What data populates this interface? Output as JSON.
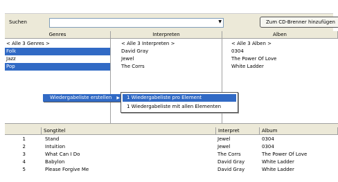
{
  "search": {
    "label": "Suchen",
    "value": "",
    "cd_button": "Zum CD-Brenner hinzufügen"
  },
  "panes": {
    "genres": {
      "header": "Genres",
      "items": [
        "< Alle 3 Genres >",
        "Folk",
        "Jazz",
        "Pop"
      ]
    },
    "artists": {
      "header": "Interpreten",
      "items": [
        "< Alle 3 Interpreten >",
        "David Gray",
        "Jewel",
        "The Corrs"
      ]
    },
    "albums": {
      "header": "Alben",
      "items": [
        "< Alle 3 Alben >",
        "0304",
        "The Power Of Love",
        "White Ladder"
      ]
    }
  },
  "context_menu": {
    "item": "Wiedergabeliste erstellen",
    "submenu": [
      "1 Wiedergabeliste pro Element",
      "1 Wiedergabeliste mit allen Elementen"
    ]
  },
  "songs": {
    "columns": [
      "",
      "Songtitel",
      "Interpret",
      "Album"
    ],
    "rows": [
      {
        "n": "1",
        "title": "Stand",
        "artist": "Jewel",
        "album": "0304"
      },
      {
        "n": "2",
        "title": "Intuition",
        "artist": "Jewel",
        "album": "0304"
      },
      {
        "n": "3",
        "title": "What Can I Do",
        "artist": "The Corrs",
        "album": "The Power Of Love"
      },
      {
        "n": "4",
        "title": "Babylon",
        "artist": "David Gray",
        "album": "White Ladder"
      },
      {
        "n": "5",
        "title": "Please Forgive Me",
        "artist": "David Gray",
        "album": "White Ladder"
      }
    ]
  },
  "colors": {
    "selection": "#316ac5",
    "chrome": "#ece9d8"
  }
}
